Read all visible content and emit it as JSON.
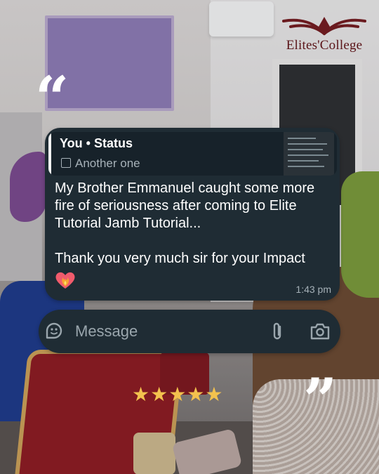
{
  "brand": {
    "logo_text": "Elites'College",
    "book_color": "#6a1a1f"
  },
  "quote_marks": {
    "open": "“",
    "close": "”"
  },
  "chat": {
    "reply_author": "You",
    "reply_separator": " • ",
    "reply_type": "Status",
    "reply_caption": "Another one",
    "message_text": "My Brother Emmanuel caught some more fire of seriousness after coming to Elite Tutorial Jamb Tutorial...\n\nThank you very much sir for your Impact",
    "time": "1:43 pm",
    "bubble_color": "#1f2c34"
  },
  "composer": {
    "placeholder": "Message"
  },
  "rating": {
    "stars": "★★★★★",
    "value": 5,
    "max": 5,
    "color": "#f3c24e"
  }
}
